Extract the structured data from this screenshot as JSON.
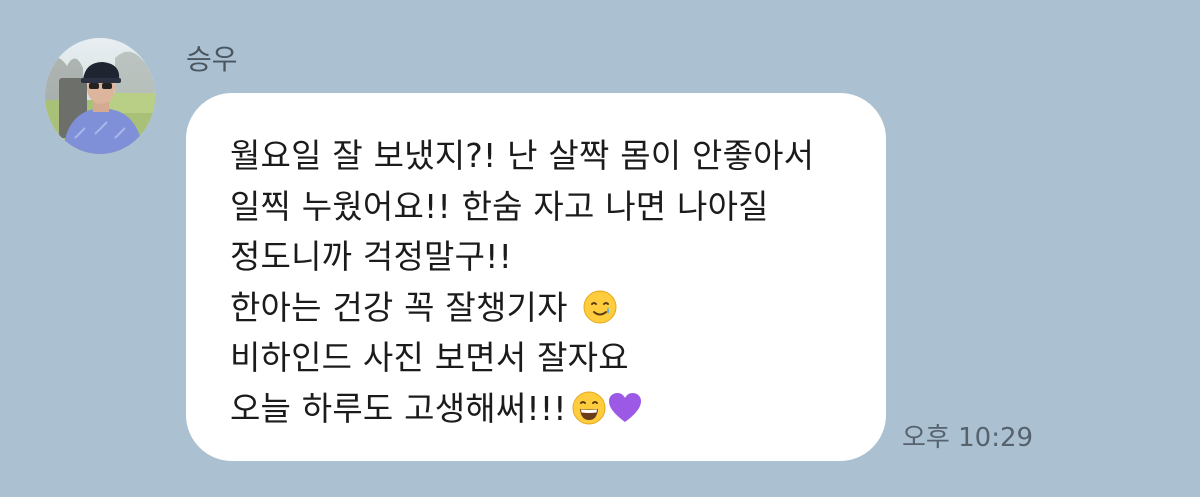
{
  "sender": {
    "name": "승우"
  },
  "message": {
    "lines": [
      "월요일 잘 보냈지?! 난 살짝 몸이 안좋아서",
      "일찍 누웠어요!! 한숨 자고 나면 나아질",
      "정도니까 걱정말구!!",
      "한아는 건강 꼭 잘챙기자",
      "비하인드 사진 보면서 잘자요",
      "오늘 하루도 고생해써!!!"
    ],
    "emojis": {
      "line4": "smiling-face-with-tear-icon",
      "line6a": "grinning-squinting-face-icon",
      "line6b": "purple-heart-icon"
    },
    "timestamp": "오후 10:29"
  },
  "colors": {
    "background": "#abc1d1",
    "bubble": "#ffffff",
    "text": "#1b1b1b",
    "meta_text": "#56626d",
    "heart": "#9b59e6"
  }
}
